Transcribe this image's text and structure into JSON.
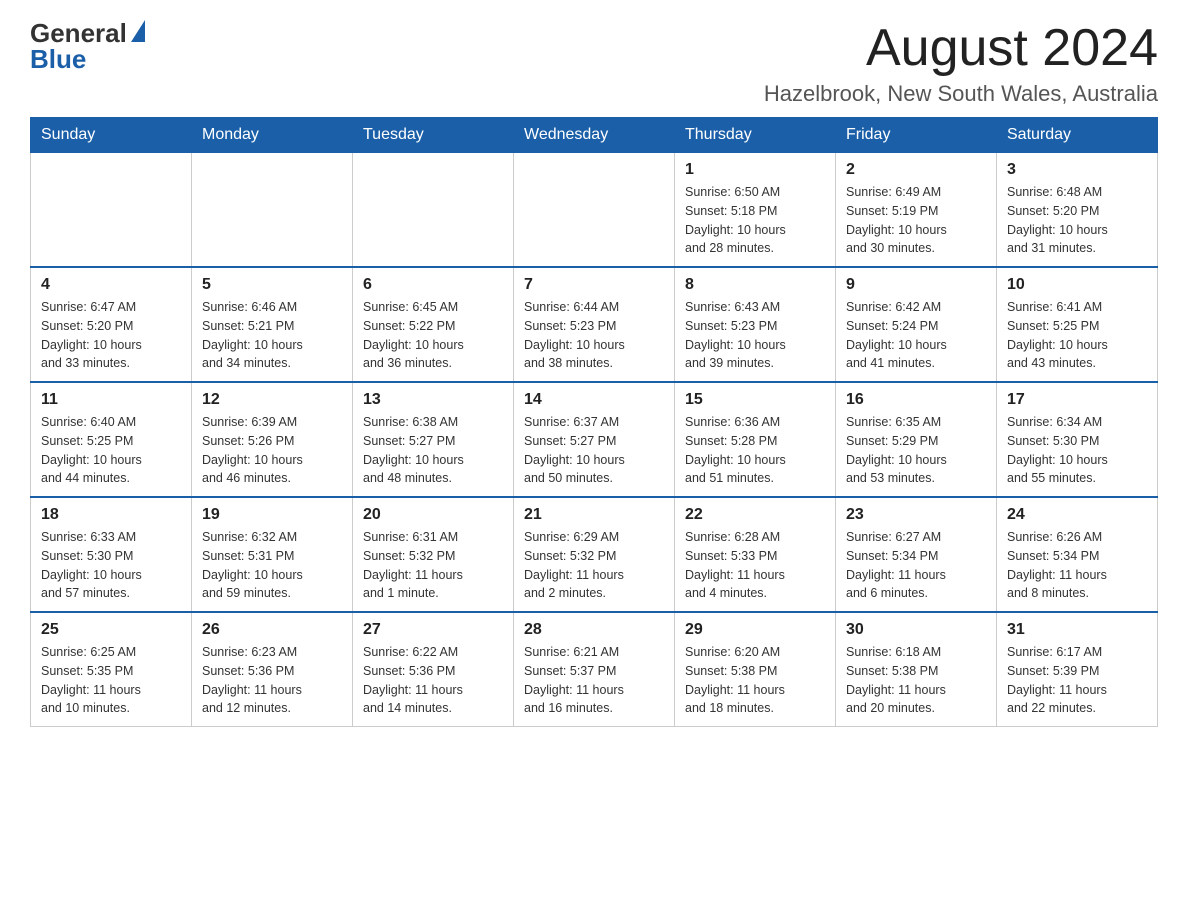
{
  "logo": {
    "general": "General",
    "blue": "Blue"
  },
  "title": "August 2024",
  "subtitle": "Hazelbrook, New South Wales, Australia",
  "weekdays": [
    "Sunday",
    "Monday",
    "Tuesday",
    "Wednesday",
    "Thursday",
    "Friday",
    "Saturday"
  ],
  "weeks": [
    [
      {
        "day": "",
        "info": ""
      },
      {
        "day": "",
        "info": ""
      },
      {
        "day": "",
        "info": ""
      },
      {
        "day": "",
        "info": ""
      },
      {
        "day": "1",
        "info": "Sunrise: 6:50 AM\nSunset: 5:18 PM\nDaylight: 10 hours\nand 28 minutes."
      },
      {
        "day": "2",
        "info": "Sunrise: 6:49 AM\nSunset: 5:19 PM\nDaylight: 10 hours\nand 30 minutes."
      },
      {
        "day": "3",
        "info": "Sunrise: 6:48 AM\nSunset: 5:20 PM\nDaylight: 10 hours\nand 31 minutes."
      }
    ],
    [
      {
        "day": "4",
        "info": "Sunrise: 6:47 AM\nSunset: 5:20 PM\nDaylight: 10 hours\nand 33 minutes."
      },
      {
        "day": "5",
        "info": "Sunrise: 6:46 AM\nSunset: 5:21 PM\nDaylight: 10 hours\nand 34 minutes."
      },
      {
        "day": "6",
        "info": "Sunrise: 6:45 AM\nSunset: 5:22 PM\nDaylight: 10 hours\nand 36 minutes."
      },
      {
        "day": "7",
        "info": "Sunrise: 6:44 AM\nSunset: 5:23 PM\nDaylight: 10 hours\nand 38 minutes."
      },
      {
        "day": "8",
        "info": "Sunrise: 6:43 AM\nSunset: 5:23 PM\nDaylight: 10 hours\nand 39 minutes."
      },
      {
        "day": "9",
        "info": "Sunrise: 6:42 AM\nSunset: 5:24 PM\nDaylight: 10 hours\nand 41 minutes."
      },
      {
        "day": "10",
        "info": "Sunrise: 6:41 AM\nSunset: 5:25 PM\nDaylight: 10 hours\nand 43 minutes."
      }
    ],
    [
      {
        "day": "11",
        "info": "Sunrise: 6:40 AM\nSunset: 5:25 PM\nDaylight: 10 hours\nand 44 minutes."
      },
      {
        "day": "12",
        "info": "Sunrise: 6:39 AM\nSunset: 5:26 PM\nDaylight: 10 hours\nand 46 minutes."
      },
      {
        "day": "13",
        "info": "Sunrise: 6:38 AM\nSunset: 5:27 PM\nDaylight: 10 hours\nand 48 minutes."
      },
      {
        "day": "14",
        "info": "Sunrise: 6:37 AM\nSunset: 5:27 PM\nDaylight: 10 hours\nand 50 minutes."
      },
      {
        "day": "15",
        "info": "Sunrise: 6:36 AM\nSunset: 5:28 PM\nDaylight: 10 hours\nand 51 minutes."
      },
      {
        "day": "16",
        "info": "Sunrise: 6:35 AM\nSunset: 5:29 PM\nDaylight: 10 hours\nand 53 minutes."
      },
      {
        "day": "17",
        "info": "Sunrise: 6:34 AM\nSunset: 5:30 PM\nDaylight: 10 hours\nand 55 minutes."
      }
    ],
    [
      {
        "day": "18",
        "info": "Sunrise: 6:33 AM\nSunset: 5:30 PM\nDaylight: 10 hours\nand 57 minutes."
      },
      {
        "day": "19",
        "info": "Sunrise: 6:32 AM\nSunset: 5:31 PM\nDaylight: 10 hours\nand 59 minutes."
      },
      {
        "day": "20",
        "info": "Sunrise: 6:31 AM\nSunset: 5:32 PM\nDaylight: 11 hours\nand 1 minute."
      },
      {
        "day": "21",
        "info": "Sunrise: 6:29 AM\nSunset: 5:32 PM\nDaylight: 11 hours\nand 2 minutes."
      },
      {
        "day": "22",
        "info": "Sunrise: 6:28 AM\nSunset: 5:33 PM\nDaylight: 11 hours\nand 4 minutes."
      },
      {
        "day": "23",
        "info": "Sunrise: 6:27 AM\nSunset: 5:34 PM\nDaylight: 11 hours\nand 6 minutes."
      },
      {
        "day": "24",
        "info": "Sunrise: 6:26 AM\nSunset: 5:34 PM\nDaylight: 11 hours\nand 8 minutes."
      }
    ],
    [
      {
        "day": "25",
        "info": "Sunrise: 6:25 AM\nSunset: 5:35 PM\nDaylight: 11 hours\nand 10 minutes."
      },
      {
        "day": "26",
        "info": "Sunrise: 6:23 AM\nSunset: 5:36 PM\nDaylight: 11 hours\nand 12 minutes."
      },
      {
        "day": "27",
        "info": "Sunrise: 6:22 AM\nSunset: 5:36 PM\nDaylight: 11 hours\nand 14 minutes."
      },
      {
        "day": "28",
        "info": "Sunrise: 6:21 AM\nSunset: 5:37 PM\nDaylight: 11 hours\nand 16 minutes."
      },
      {
        "day": "29",
        "info": "Sunrise: 6:20 AM\nSunset: 5:38 PM\nDaylight: 11 hours\nand 18 minutes."
      },
      {
        "day": "30",
        "info": "Sunrise: 6:18 AM\nSunset: 5:38 PM\nDaylight: 11 hours\nand 20 minutes."
      },
      {
        "day": "31",
        "info": "Sunrise: 6:17 AM\nSunset: 5:39 PM\nDaylight: 11 hours\nand 22 minutes."
      }
    ]
  ]
}
